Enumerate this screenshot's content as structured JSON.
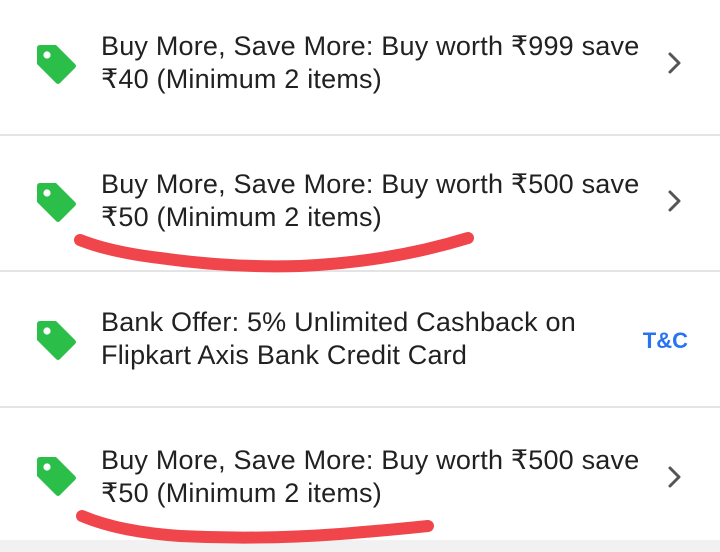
{
  "offers": [
    {
      "line1": "Buy More, Save More: Buy worth ₹999 save",
      "line2": "₹40 (Minimum 2 items)",
      "icon": "tag-icon",
      "action": "chevron"
    },
    {
      "line1": "Buy More, Save More: Buy worth ₹500 save",
      "line2": "₹50 (Minimum 2 items)",
      "icon": "tag-icon",
      "action": "chevron"
    },
    {
      "line1": "Bank Offer: 5% Unlimited Cashback on",
      "line2": "Flipkart Axis Bank Credit Card",
      "icon": "tag-icon",
      "action_label": "T&C"
    },
    {
      "line1": "Buy More, Save More: Buy worth ₹500 save",
      "line2": "₹50 (Minimum 2 items)",
      "icon": "tag-icon",
      "action": "chevron"
    }
  ],
  "colors": {
    "tag_icon": "#2bbf4a",
    "text": "#212121",
    "link": "#2874f0",
    "chevron": "#555555",
    "divider": "#e4e4e4",
    "annotation": "#f0454a"
  }
}
